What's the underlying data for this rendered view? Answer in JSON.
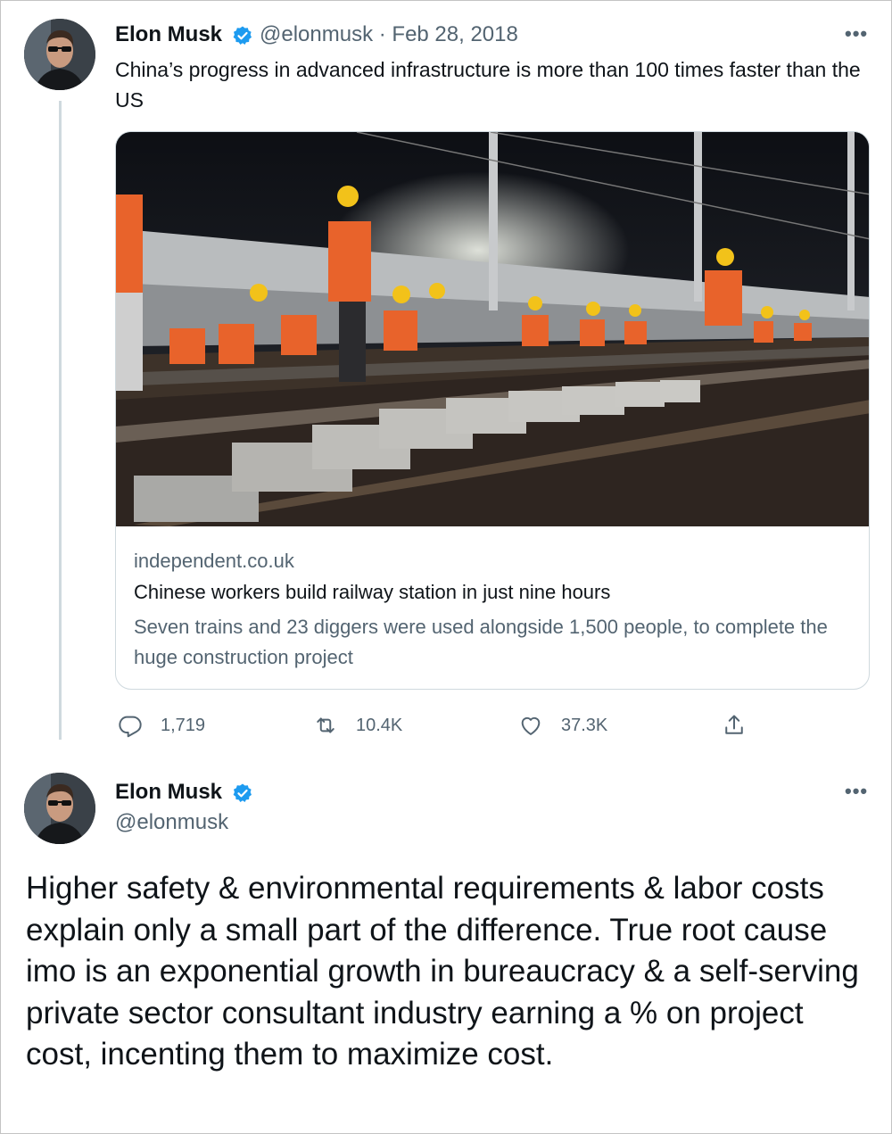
{
  "tweet": {
    "author_name": "Elon Musk",
    "handle_date": "@elonmusk · Feb 28, 2018",
    "more": "•••",
    "text": "China’s progress in advanced infrastructure is more than 100 times faster than the US",
    "card": {
      "domain": "independent.co.uk",
      "title": "Chinese workers build railway station in just nine hours",
      "description": "Seven trains and 23 diggers were used alongside 1,500 people, to complete the huge construction project"
    },
    "actions": {
      "reply_count": "1,719",
      "retweet_count": "10.4K",
      "like_count": "37.3K"
    }
  },
  "reply": {
    "author_name": "Elon Musk",
    "handle": "@elonmusk",
    "more": "•••",
    "text": "Higher safety & environmental requirements & labor costs explain only a small part of the difference. True root cause imo is an exponential growth in bureaucracy & a self-serving private sector consultant industry earning a % on project cost, incenting them to maximize cost."
  },
  "icons": [
    "verified-icon",
    "reply-icon",
    "retweet-icon",
    "like-icon",
    "share-icon",
    "more-icon"
  ],
  "colors": {
    "verified": "#1d9bf0",
    "secondary_text": "#536471",
    "border": "#cfd9de"
  }
}
